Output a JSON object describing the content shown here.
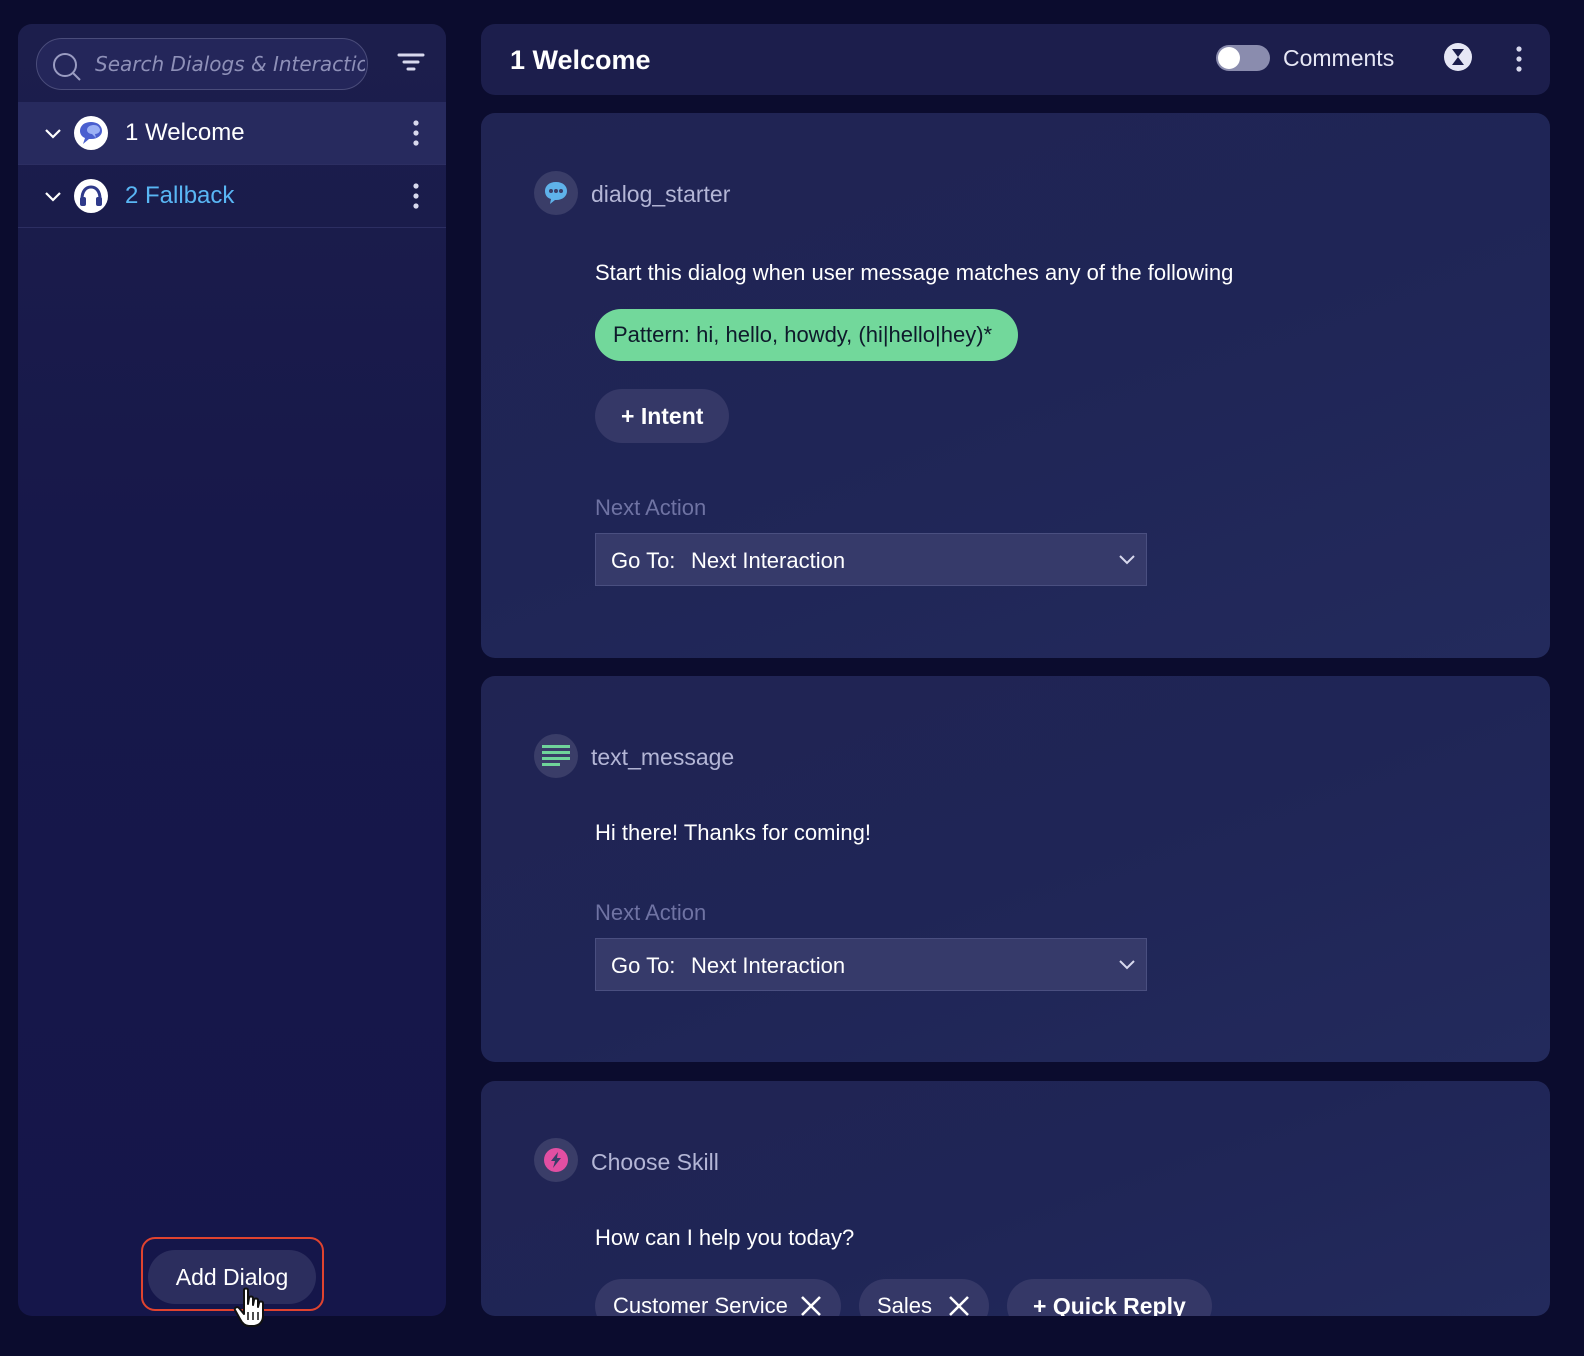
{
  "sidebar": {
    "search_placeholder": "Search Dialogs & Interactio...",
    "dialogs": [
      {
        "label": "1 Welcome",
        "active": true
      },
      {
        "label": "2 Fallback",
        "active": false
      }
    ],
    "add_dialog_label": "Add Dialog"
  },
  "header": {
    "title": "1 Welcome",
    "comments_label": "Comments",
    "comments_enabled": false
  },
  "cards": {
    "starter": {
      "type_label": "dialog_starter",
      "description": "Start this dialog when user message matches any of the following",
      "pattern_text": "Pattern:  hi, hello, howdy, (hi|hello|hey)*",
      "intent_button": "+ Intent",
      "next_action_label": "Next Action",
      "goto_prefix": "Go To:",
      "goto_value": "Next Interaction"
    },
    "text_message": {
      "type_label": "text_message",
      "message": "Hi there! Thanks for coming!",
      "next_action_label": "Next Action",
      "goto_prefix": "Go To:",
      "goto_value": "Next Interaction"
    },
    "choose_skill": {
      "type_label": "Choose Skill",
      "prompt": "How can I help you today?",
      "quick_replies": [
        "Customer Service",
        "Sales"
      ],
      "add_quick_reply": "+ Quick Reply"
    }
  },
  "icons": {
    "search": "search-icon",
    "filter": "filter-icon",
    "chevron": "chevron-down-icon",
    "kebab": "more-vertical-icon",
    "hourglass": "hourglass-icon",
    "chat": "chat-bubble-icon",
    "text": "text-lines-icon",
    "skill": "lightning-icon",
    "close": "close-icon"
  },
  "colors": {
    "background": "#0b0c2e",
    "panel": "#1c1e4c",
    "accent_link": "#59b6f4",
    "pattern_chip": "#72d89b",
    "highlight_border": "#e0432f"
  }
}
